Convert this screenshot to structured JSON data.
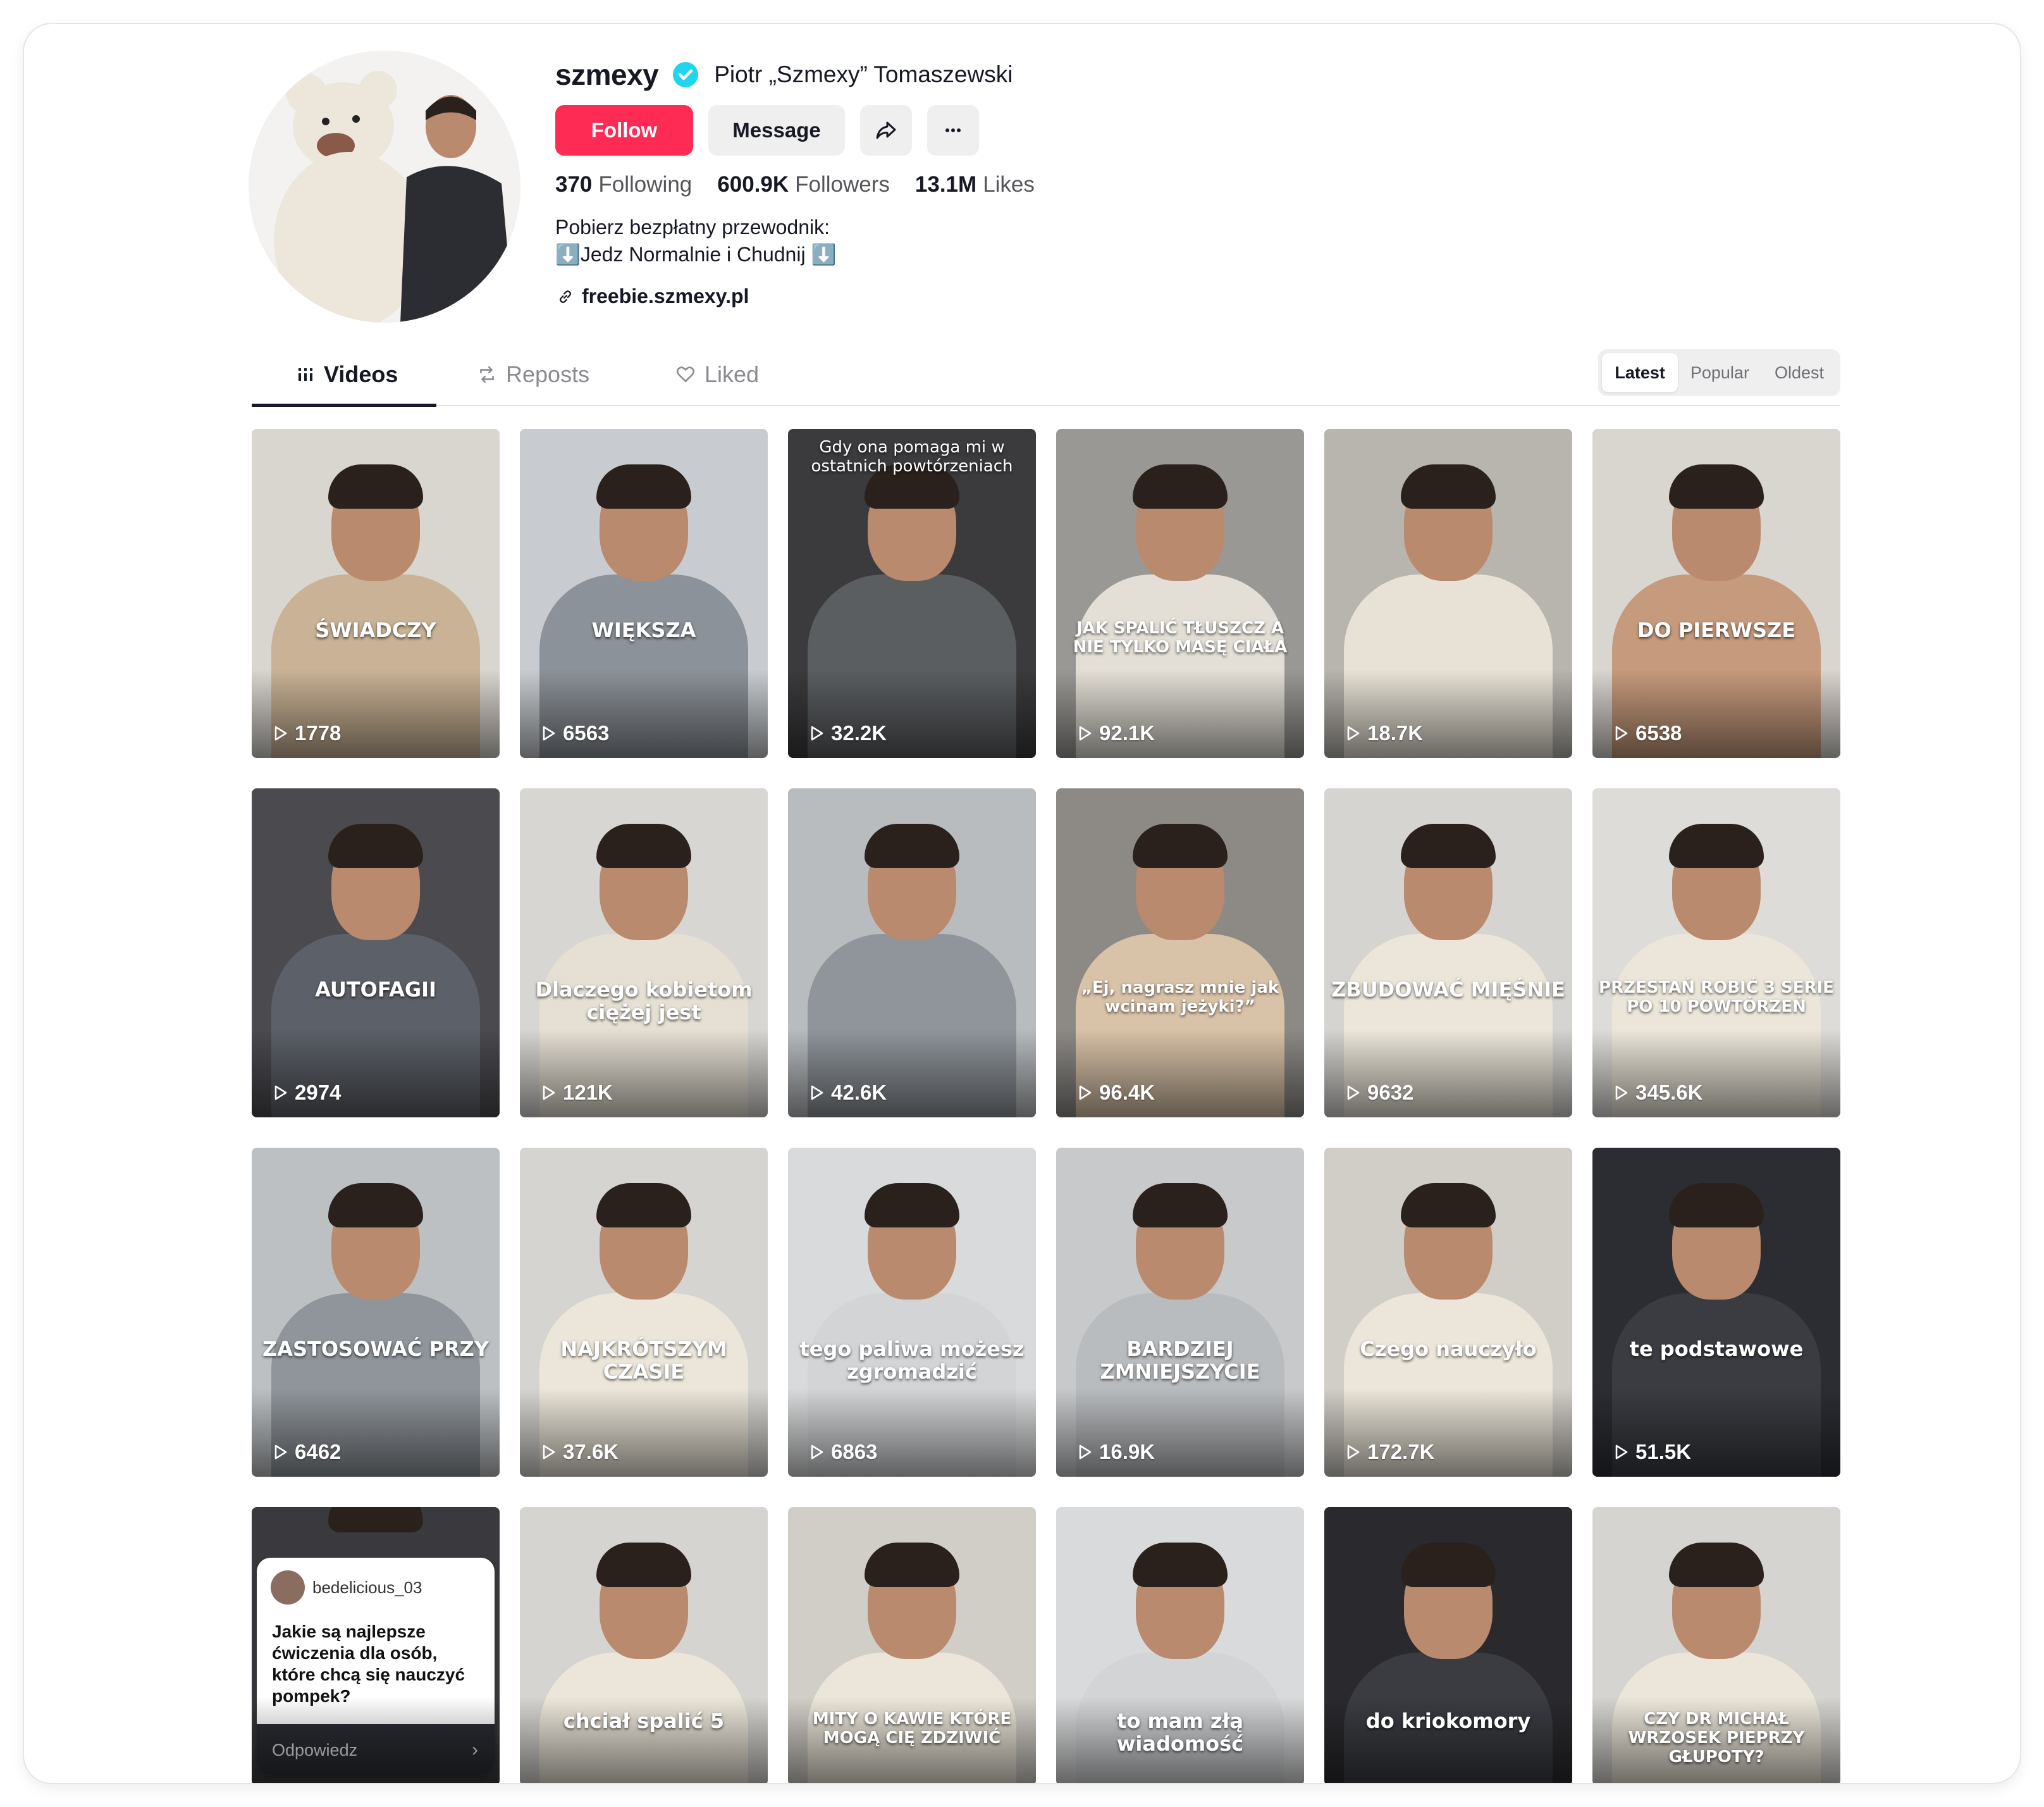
{
  "profile": {
    "username": "szmexy",
    "nickname": "Piotr „Szmexy” Tomaszewski",
    "follow_label": "Follow",
    "message_label": "Message",
    "stats": {
      "following_count": "370",
      "following_label": "Following",
      "followers_count": "600.9K",
      "followers_label": "Followers",
      "likes_count": "13.1M",
      "likes_label": "Likes"
    },
    "bio_line1": "Pobierz bezpłatny przewodnik:",
    "bio_line2": "⬇️Jedz Normalnie i Chudnij ⬇️",
    "link": "freebie.szmexy.pl"
  },
  "tabs": [
    {
      "label": "Videos",
      "icon": "grid-icon",
      "active": true
    },
    {
      "label": "Reposts",
      "icon": "repost-icon",
      "active": false
    },
    {
      "label": "Liked",
      "icon": "heart-icon",
      "active": false
    }
  ],
  "sort": [
    {
      "label": "Latest",
      "active": true
    },
    {
      "label": "Popular",
      "active": false
    },
    {
      "label": "Oldest",
      "active": false
    }
  ],
  "colors": {
    "accent": "#fe2c55",
    "verified": "#20d5ec"
  },
  "videos": [
    {
      "views": "1778",
      "caption": "ŚWIADCZY",
      "bg": "#d9d5cf",
      "shirt": "#c9b295"
    },
    {
      "views": "6563",
      "caption": "WIĘKSZA",
      "bg": "#c8ccd0",
      "shirt": "#8c9299"
    },
    {
      "views": "32.2K",
      "caption_top": "Gdy ona pomaga mi w ostatnich powtórzeniach",
      "bg": "#3b3a3c",
      "shirt": "#5b5e61"
    },
    {
      "views": "92.1K",
      "caption": "JAK SPALIĆ TŁUSZCZ A NIE TYLKO MASĘ CIAŁA",
      "bg": "#9a9894",
      "shirt": "#e3dfd6"
    },
    {
      "views": "18.7K",
      "caption": "",
      "bg": "#b8b4ae",
      "shirt": "#e8e2d6"
    },
    {
      "views": "6538",
      "caption": "DO PIERWSZE",
      "bg": "#d9d5cf",
      "shirt": "#c69a7c"
    },
    {
      "views": "2974",
      "caption": "AUTOFAGII",
      "bg": "#4a4a4f",
      "shirt": "#5c6068"
    },
    {
      "views": "121K",
      "caption": "Dlaczego kobietom ciężej jest",
      "bg": "#d8d6d2",
      "shirt": "#e6e0d4"
    },
    {
      "views": "42.6K",
      "caption": "",
      "bg": "#b8bcbf",
      "shirt": "#8f959b"
    },
    {
      "views": "96.4K",
      "caption": "„Ej, nagrasz mnie jak wcinam jeżyki?”",
      "bg": "#8d8a86",
      "shirt": "#d8c2a8"
    },
    {
      "views": "9632",
      "caption": "ZBUDOWAĆ MIĘŚNIE",
      "bg": "#d6d4d0",
      "shirt": "#ece6da"
    },
    {
      "views": "345.6K",
      "caption": "PRZESTAŃ ROBIĆ 3 SERIE PO 10 POWTÓRZEŃ",
      "bg": "#dedcd8",
      "shirt": "#ece6da"
    },
    {
      "views": "6462",
      "caption": "ZASTOSOWAĆ PRZY",
      "bg": "#bcc0c3",
      "shirt": "#8f959b"
    },
    {
      "views": "37.6K",
      "caption": "NAJKRÓTSZYM CZASIE",
      "bg": "#d6d4d0",
      "shirt": "#ece6da"
    },
    {
      "views": "6863",
      "caption": "tego paliwa możesz zgromadzić",
      "bg": "#d9dadb",
      "shirt": "#d2d4d6"
    },
    {
      "views": "16.9K",
      "caption": "BARDZIEJ ZMNIEJSZYCIE",
      "bg": "#c7c9cb",
      "shirt": "#b9bcbf"
    },
    {
      "views": "172.7K",
      "caption": "Czego nauczyło",
      "bg": "#d1cdc7",
      "shirt": "#ece6da"
    },
    {
      "views": "51.5K",
      "caption": "te podstawowe",
      "bg": "#2c2d33",
      "shirt": "#3a3c42"
    },
    {
      "views": "",
      "caption": "",
      "bg": "#3a3a3e",
      "shirt": "#3a3a3e",
      "comment": {
        "user": "bedelicious_03",
        "text": "Jakie są najlepsze ćwiczenia dla osób, które chcą się nauczyć pompek?",
        "reply": "Odpowiedz"
      }
    },
    {
      "views": "",
      "caption": "chciał spalić 5",
      "bg": "#d6d4d0",
      "shirt": "#ece6da"
    },
    {
      "views": "",
      "caption": "MITY O KAWIE KTÓRE MOGĄ CIĘ ZDZIWIĆ",
      "bg": "#d1cdc7",
      "shirt": "#ece6da"
    },
    {
      "views": "",
      "caption": "to mam złą wiadomość",
      "bg": "#d9dadb",
      "shirt": "#d2d4d6"
    },
    {
      "views": "",
      "caption": "do kriokomory",
      "bg": "#2a2a2e",
      "shirt": "#3a3c42"
    },
    {
      "views": "",
      "caption": "CZY DR MICHAŁ WRZOSEK PIEPRZY GŁUPOTY?",
      "bg": "#d6d4d0",
      "shirt": "#ece6da"
    }
  ]
}
